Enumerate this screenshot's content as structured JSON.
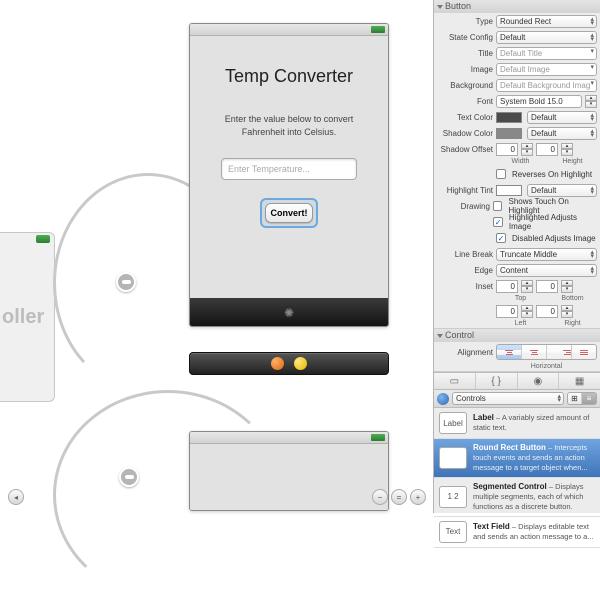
{
  "canvas": {
    "controller_label": "oller",
    "phone": {
      "title": "Temp Converter",
      "subtitle_line1": "Enter the value below to convert",
      "subtitle_line2": "Fahrenheit into Celsius.",
      "placeholder": "Enter Temperature...",
      "button_label": "Convert!"
    }
  },
  "inspector": {
    "sections": {
      "button_title": "Button",
      "control_title": "Control"
    },
    "type": {
      "label": "Type",
      "value": "Rounded Rect"
    },
    "state": {
      "label": "State Config",
      "value": "Default"
    },
    "title": {
      "label": "Title",
      "value": "Default Title"
    },
    "image": {
      "label": "Image",
      "value": "Default Image"
    },
    "background": {
      "label": "Background",
      "value": "Default Background Imag"
    },
    "font": {
      "label": "Font",
      "value": "System Bold 15.0"
    },
    "textcolor": {
      "label": "Text Color",
      "value": "Default"
    },
    "shadowcolor": {
      "label": "Shadow Color",
      "value": "Default"
    },
    "shadowoffset": {
      "label": "Shadow Offset",
      "w_label": "Width",
      "h_label": "Height",
      "w": "0",
      "h": "0"
    },
    "reverses": "Reverses On Highlight",
    "highlighttint": {
      "label": "Highlight Tint",
      "value": "Default"
    },
    "drawing": {
      "label": "Drawing",
      "shows_touch": "Shows Touch On Highlight",
      "highlighted": "Highlighted Adjusts Image",
      "disabled": "Disabled Adjusts Image"
    },
    "linebreak": {
      "label": "Line Break",
      "value": "Truncate Middle"
    },
    "edge": {
      "label": "Edge",
      "value": "Content"
    },
    "inset": {
      "label": "Inset",
      "t_label": "Top",
      "b_label": "Bottom",
      "l_label": "Left",
      "r_label": "Right",
      "v": "0"
    },
    "alignment": {
      "label": "Alignment",
      "horiz_label": "Horizontal"
    },
    "library": {
      "popup": "Controls",
      "items": [
        {
          "head": "Label",
          "title": "Label",
          "body": " – A variably sized amount of static text."
        },
        {
          "head": "",
          "title": "Round Rect Button",
          "body": " – Intercepts touch events and sends an action message to a target object when..."
        },
        {
          "head": "1 2",
          "title": "Segmented Control",
          "body": " – Displays multiple segments, each of which functions as a discrete button."
        },
        {
          "head": "Text",
          "title": "Text Field",
          "body": " – Displays editable text and sends an action message to a..."
        }
      ]
    }
  },
  "zoom": {
    "out": "−",
    "fit": "=",
    "in": "+"
  }
}
